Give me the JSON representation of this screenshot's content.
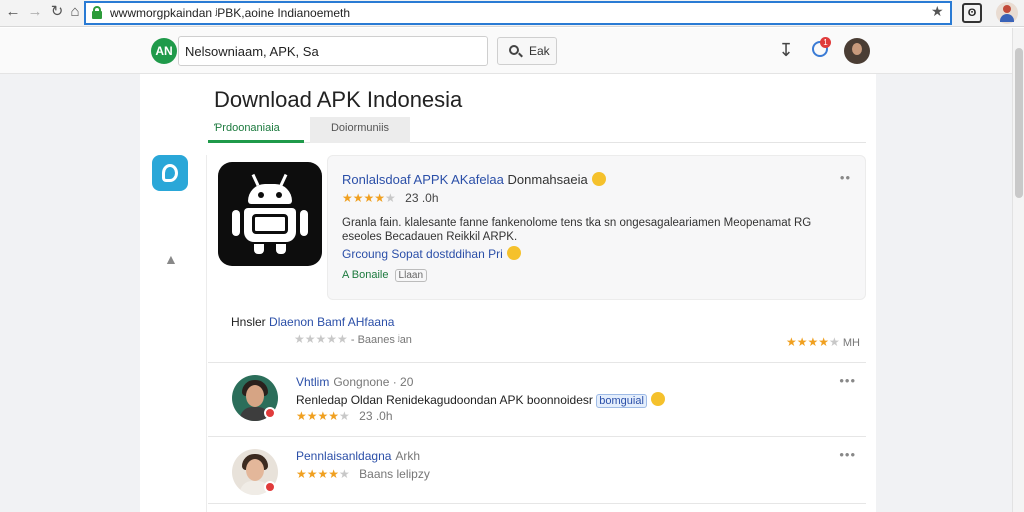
{
  "browser": {
    "url": "ᴡᴡᴡmorgpkaindan ʲPBK,aoine Indianoemeth"
  },
  "header": {
    "logo_text": "ΑΝ",
    "search_value": "Nelsowniaam, APK, Sa",
    "search_button": "Eak",
    "notification_count": "1"
  },
  "main": {
    "page_title": "Download APK Indonesia",
    "tabs": [
      {
        "label": "Ƥrdoonaniaia"
      },
      {
        "label": "Doiormuniis"
      }
    ]
  },
  "featured_app": {
    "name": "Ronlalsdoaf APPK AKafelaa",
    "developer": "Donmahsaeia",
    "rating_value": "23 .0h",
    "rating_stars": 4,
    "description": "Granla fain. klalesante fanne fankenolome tens tka  sn ongesagaleariamen Meopenamat RG eseoles Becadauen Reikkil ARPK.",
    "link_text": "Grcoung Sopat dostddihan Pri",
    "meta_label": "A Bonaile",
    "meta_tag": "Llaan"
  },
  "reviews": {
    "title": "Hnsler",
    "title_link": "Dlaenon Bamf AHfaana",
    "subtitle": "- Baanes ʲan",
    "overall_value": "MH",
    "overall_stars": 4,
    "items": [
      {
        "name": "Vhtlim",
        "date": "Gongnone · 20",
        "text": "Renledap Oldan Renidekagudoondan APK boonnoidesr",
        "chip": "bomguial",
        "rating_value": "23 .0h",
        "rating_stars": 4,
        "avatar_bg": "#2b6e5a"
      },
      {
        "name": "Pennlaisanldagna",
        "date": "Arkh",
        "text": "",
        "chip": "",
        "rating_value": "Baans lelipzy",
        "rating_stars": 4,
        "avatar_bg": "#e8e2da"
      }
    ]
  },
  "colors": {
    "accent_green": "#1f9a4a",
    "link_blue": "#2b4fa8",
    "star_gold": "#f0a020",
    "address_border": "#2a7bd4"
  },
  "icons": [
    "back-arrow-icon",
    "forward-arrow-icon",
    "reload-icon",
    "home-icon",
    "lock-icon",
    "bookmark-star-icon",
    "extension-icon",
    "profile-icon",
    "search-icon",
    "download-icon",
    "notification-icon",
    "android-robot-icon",
    "more-dots-icon"
  ]
}
